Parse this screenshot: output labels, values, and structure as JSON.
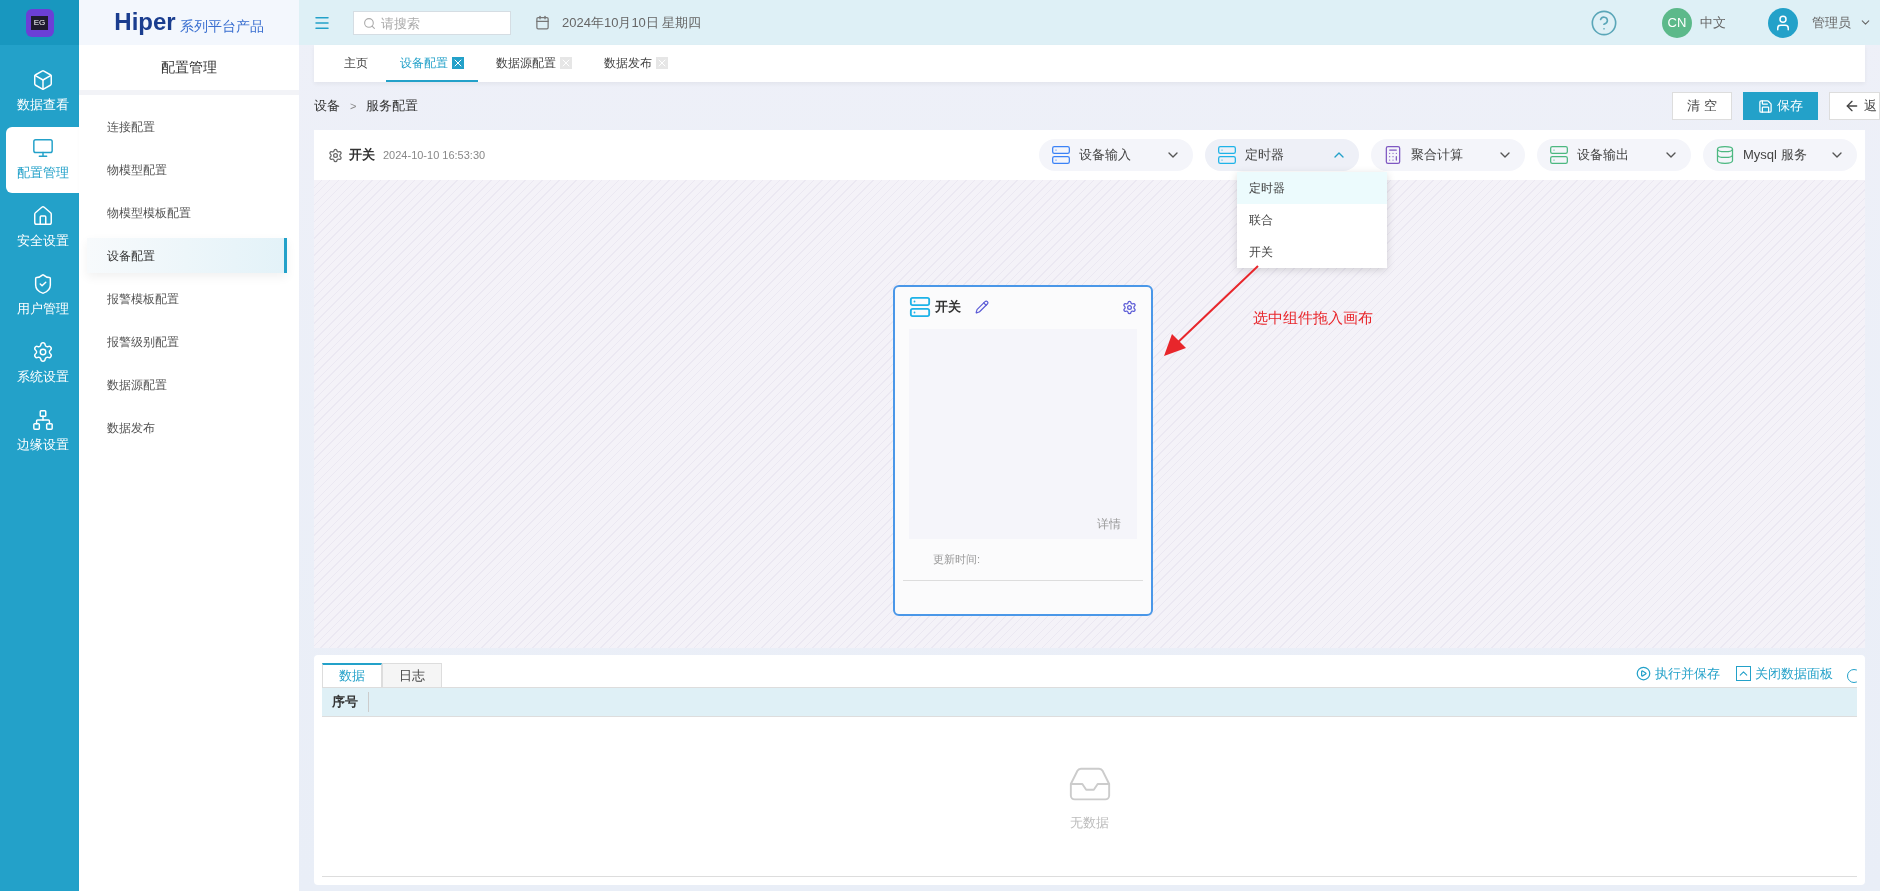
{
  "logo": {
    "text": "EG"
  },
  "rail": [
    {
      "label": "数据查看",
      "selected": false
    },
    {
      "label": "配置管理",
      "selected": true
    },
    {
      "label": "安全设置",
      "selected": false
    },
    {
      "label": "用户管理",
      "selected": false
    },
    {
      "label": "系统设置",
      "selected": false
    },
    {
      "label": "边缘设置",
      "selected": false
    }
  ],
  "brand": {
    "name": "Hiper",
    "suffix": "系列平台产品"
  },
  "sidebar": {
    "title": "配置管理",
    "items": [
      {
        "label": "连接配置",
        "selected": false
      },
      {
        "label": "物模型配置",
        "selected": false
      },
      {
        "label": "物模型模板配置",
        "selected": false
      },
      {
        "label": "设备配置",
        "selected": true
      },
      {
        "label": "报警模板配置",
        "selected": false
      },
      {
        "label": "报警级别配置",
        "selected": false
      },
      {
        "label": "数据源配置",
        "selected": false
      },
      {
        "label": "数据发布",
        "selected": false
      }
    ]
  },
  "topbar": {
    "search_placeholder": "请搜索",
    "date": "2024年10月10日 星期四",
    "lang_badge": "CN",
    "lang": "中文",
    "user": "管理员"
  },
  "tabs": [
    {
      "label": "主页",
      "selected": false,
      "closable": false
    },
    {
      "label": "设备配置",
      "selected": true,
      "closable": true
    },
    {
      "label": "数据源配置",
      "selected": false,
      "closable": true
    },
    {
      "label": "数据发布",
      "selected": false,
      "closable": true
    }
  ],
  "breadcrumb": {
    "items": [
      "设备",
      "服务配置"
    ],
    "separator": ">"
  },
  "actions": [
    {
      "label": "清 空",
      "kind": "plain"
    },
    {
      "label": "保存",
      "kind": "primary"
    },
    {
      "label": "返",
      "kind": "back"
    }
  ],
  "service": {
    "title": "开关",
    "time": "2024-10-10 16:53:30"
  },
  "components": [
    {
      "label": "设备输入",
      "kind": "input",
      "expanded": false
    },
    {
      "label": "定时器",
      "kind": "timer",
      "expanded": true
    },
    {
      "label": "聚合计算",
      "kind": "calc",
      "expanded": false
    },
    {
      "label": "设备输出",
      "kind": "output",
      "expanded": false
    },
    {
      "label": "Mysql 服务",
      "kind": "mysql",
      "expanded": false
    }
  ],
  "dropdown": {
    "items": [
      {
        "label": "定时器",
        "selected": true
      },
      {
        "label": "联合",
        "selected": false
      },
      {
        "label": "开关",
        "selected": false
      }
    ]
  },
  "node": {
    "title": "开关",
    "detail": "详情",
    "update_label": "更新时间:"
  },
  "annotation": "选中组件拖入画布",
  "panel": {
    "tabs": [
      {
        "label": "数据",
        "selected": true
      },
      {
        "label": "日志",
        "selected": false
      }
    ],
    "actions": [
      {
        "label": "执行并保存",
        "kind": "run"
      },
      {
        "label": "关闭数据面板",
        "kind": "collapse"
      }
    ],
    "columns": [
      "序号"
    ],
    "empty": "无数据"
  }
}
